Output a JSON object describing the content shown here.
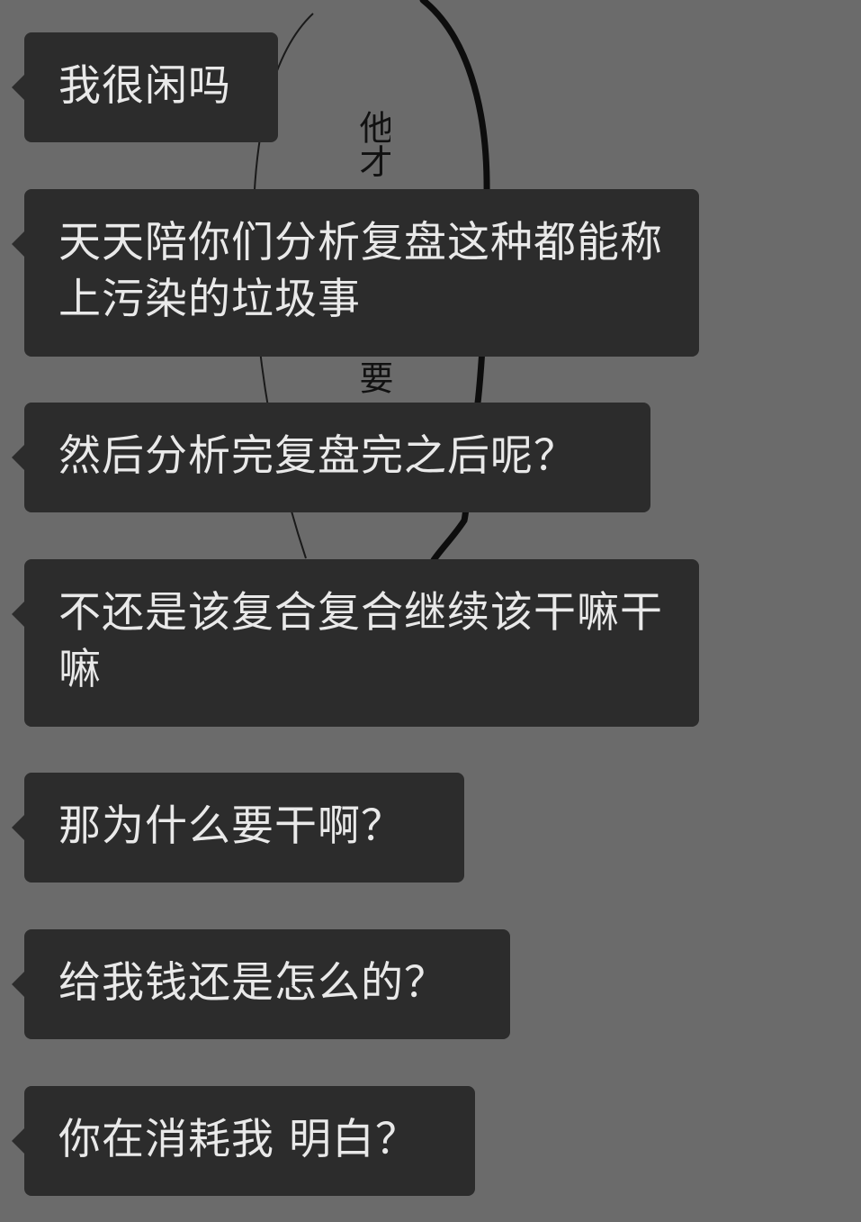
{
  "background": {
    "color": "#6b6b6b",
    "manga_text": [
      "他才",
      "要"
    ]
  },
  "bubble_color": "#2c2c2c",
  "text_color": "#e9e9e9",
  "messages": [
    {
      "text": "我很闲吗"
    },
    {
      "text": "天天陪你们分析复盘这种都能称上污染的垃圾事"
    },
    {
      "text": "然后分析完复盘完之后呢？"
    },
    {
      "text": "不还是该复合复合继续该干嘛干嘛"
    },
    {
      "text": "那为什么要干啊？"
    },
    {
      "text": "给我钱还是怎么的？"
    },
    {
      "text": "你在消耗我 明白？"
    }
  ]
}
